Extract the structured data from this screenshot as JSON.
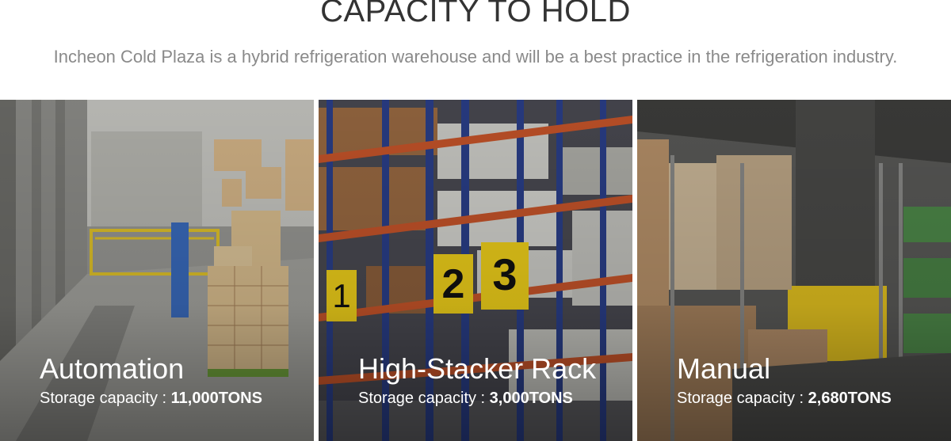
{
  "header": {
    "title": "CAPACITY TO HOLD",
    "subtitle": "Incheon Cold Plaza is a hybrid refrigeration warehouse and will be a best practice in the refrigeration industry."
  },
  "cards": [
    {
      "title": "Automation",
      "capacity_label": "Storage capacity :",
      "capacity_value": "11,000TONS"
    },
    {
      "title": "High-Stacker Rack",
      "capacity_label": "Storage capacity :",
      "capacity_value": "3,000TONS",
      "rack_numbers": [
        "1",
        "2",
        "3"
      ]
    },
    {
      "title": "Manual",
      "capacity_label": "Storage capacity :",
      "capacity_value": "2,680TONS"
    }
  ],
  "colors": {
    "title_text": "#333333",
    "subtitle_text": "#8a8a8a",
    "rack_blue": "#2a3f8a",
    "rack_orange": "#c8552a",
    "sign_yellow": "#f2d21a",
    "box_tan": "#c9a070",
    "floor_gray": "#6a6a6a"
  }
}
